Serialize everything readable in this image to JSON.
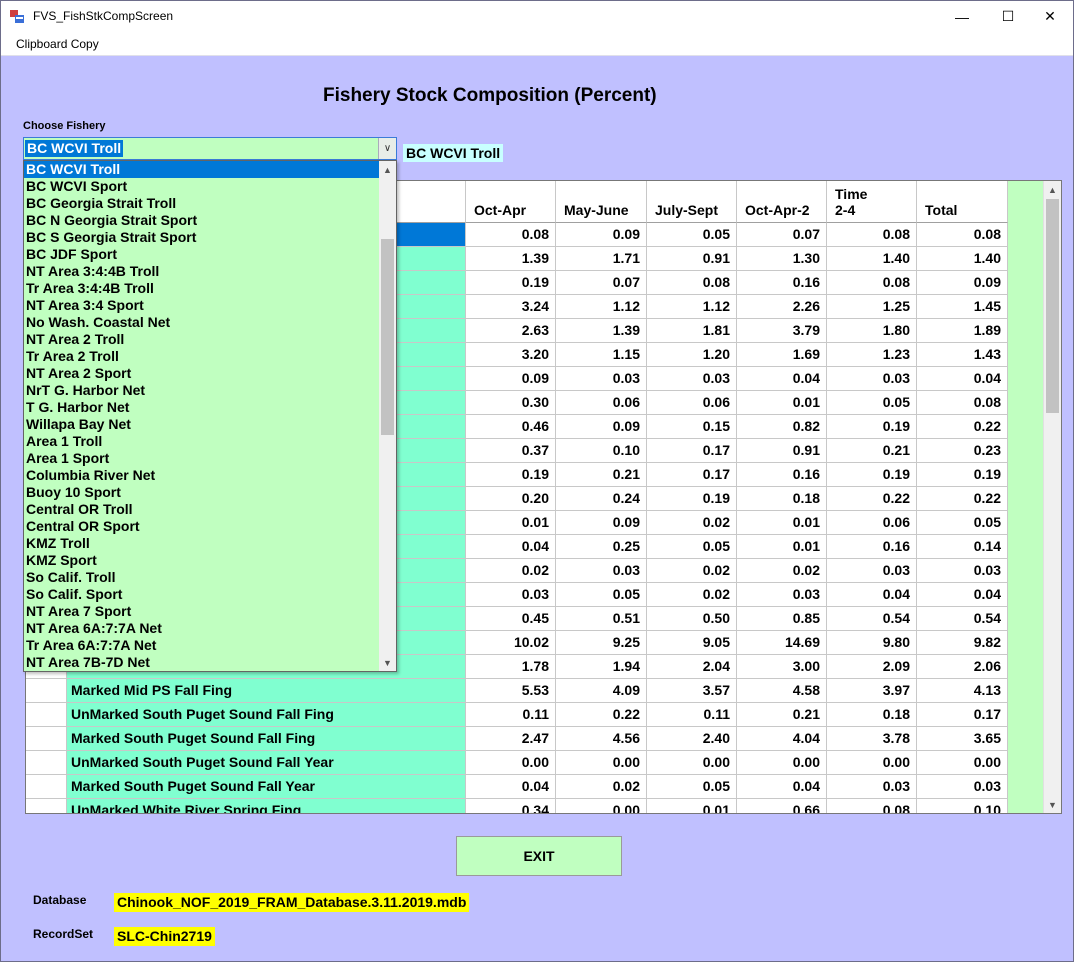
{
  "window": {
    "title": "FVS_FishStkCompScreen",
    "minimize_glyph": "—",
    "maximize_glyph": "☐",
    "close_glyph": "✕"
  },
  "menu": {
    "clipboard_copy": "Clipboard Copy"
  },
  "heading": "Fishery Stock Composition (Percent)",
  "choose_fishery": {
    "label": "Choose Fishery",
    "value": "BC WCVI Troll",
    "options": [
      "BC WCVI Troll",
      "BC WCVI Sport",
      "BC Georgia Strait Troll",
      "BC N Georgia Strait Sport",
      "BC S Georgia Strait Sport",
      "BC JDF Sport",
      "NT Area 3:4:4B Troll",
      "Tr Area 3:4:4B Troll",
      "NT Area 3:4 Sport",
      "No Wash. Coastal Net",
      "NT Area 2 Troll",
      "Tr Area 2 Troll",
      "NT Area 2 Sport",
      "NrT G. Harbor Net",
      "T G. Harbor Net",
      "Willapa Bay Net",
      "Area 1 Troll",
      "Area 1 Sport",
      "Columbia River Net",
      "Buoy 10 Sport",
      "Central OR Troll",
      "Central OR Sport",
      "KMZ Troll",
      "KMZ Sport",
      "So Calif. Troll",
      "So Calif. Sport",
      "NT Area 7 Sport",
      "NT Area 6A:7:7A Net",
      "Tr Area 6A:7:7A Net",
      "NT Area 7B-7D Net"
    ]
  },
  "selected_fishery_label": "BC WCVI Troll",
  "table": {
    "columns": [
      "Oct-Apr",
      "May-June",
      "July-Sept",
      "Oct-Apr-2",
      "Time\n2-4",
      "Total"
    ],
    "rows": [
      {
        "stock": "",
        "values": [
          "0.08",
          "0.09",
          "0.05",
          "0.07",
          "0.08",
          "0.08"
        ]
      },
      {
        "stock": "",
        "values": [
          "1.39",
          "1.71",
          "0.91",
          "1.30",
          "1.40",
          "1.40"
        ]
      },
      {
        "stock": "",
        "values": [
          "0.19",
          "0.07",
          "0.08",
          "0.16",
          "0.08",
          "0.09"
        ]
      },
      {
        "stock": "",
        "values": [
          "3.24",
          "1.12",
          "1.12",
          "2.26",
          "1.25",
          "1.45"
        ]
      },
      {
        "stock": "",
        "values": [
          "2.63",
          "1.39",
          "1.81",
          "3.79",
          "1.80",
          "1.89"
        ]
      },
      {
        "stock": "",
        "values": [
          "3.20",
          "1.15",
          "1.20",
          "1.69",
          "1.23",
          "1.43"
        ]
      },
      {
        "stock": "",
        "values": [
          "0.09",
          "0.03",
          "0.03",
          "0.04",
          "0.03",
          "0.04"
        ]
      },
      {
        "stock": "",
        "values": [
          "0.30",
          "0.06",
          "0.06",
          "0.01",
          "0.05",
          "0.08"
        ]
      },
      {
        "stock": "",
        "values": [
          "0.46",
          "0.09",
          "0.15",
          "0.82",
          "0.19",
          "0.22"
        ]
      },
      {
        "stock": "",
        "values": [
          "0.37",
          "0.10",
          "0.17",
          "0.91",
          "0.21",
          "0.23"
        ]
      },
      {
        "stock": "",
        "values": [
          "0.19",
          "0.21",
          "0.17",
          "0.16",
          "0.19",
          "0.19"
        ]
      },
      {
        "stock": "",
        "values": [
          "0.20",
          "0.24",
          "0.19",
          "0.18",
          "0.22",
          "0.22"
        ]
      },
      {
        "stock": "",
        "values": [
          "0.01",
          "0.09",
          "0.02",
          "0.01",
          "0.06",
          "0.05"
        ]
      },
      {
        "stock": "",
        "values": [
          "0.04",
          "0.25",
          "0.05",
          "0.01",
          "0.16",
          "0.14"
        ]
      },
      {
        "stock": "",
        "values": [
          "0.02",
          "0.03",
          "0.02",
          "0.02",
          "0.03",
          "0.03"
        ]
      },
      {
        "stock": "",
        "values": [
          "0.03",
          "0.05",
          "0.02",
          "0.03",
          "0.04",
          "0.04"
        ]
      },
      {
        "stock": "",
        "values": [
          "0.45",
          "0.51",
          "0.50",
          "0.85",
          "0.54",
          "0.54"
        ]
      },
      {
        "stock": "",
        "values": [
          "10.02",
          "9.25",
          "9.05",
          "14.69",
          "9.80",
          "9.82"
        ]
      },
      {
        "stock": "",
        "values": [
          "1.78",
          "1.94",
          "2.04",
          "3.00",
          "2.09",
          "2.06"
        ]
      },
      {
        "stock": "Marked Mid PS Fall Fing",
        "values": [
          "5.53",
          "4.09",
          "3.57",
          "4.58",
          "3.97",
          "4.13"
        ]
      },
      {
        "stock": "UnMarked South Puget Sound Fall Fing",
        "values": [
          "0.11",
          "0.22",
          "0.11",
          "0.21",
          "0.18",
          "0.17"
        ]
      },
      {
        "stock": "Marked South Puget Sound Fall Fing",
        "values": [
          "2.47",
          "4.56",
          "2.40",
          "4.04",
          "3.78",
          "3.65"
        ]
      },
      {
        "stock": "UnMarked South Puget Sound Fall Year",
        "values": [
          "0.00",
          "0.00",
          "0.00",
          "0.00",
          "0.00",
          "0.00"
        ]
      },
      {
        "stock": "Marked South Puget Sound Fall Year",
        "values": [
          "0.04",
          "0.02",
          "0.05",
          "0.04",
          "0.03",
          "0.03"
        ]
      },
      {
        "stock": "UnMarked White River Spring Fing",
        "values": [
          "0.34",
          "0.00",
          "0.01",
          "0.66",
          "0.08",
          "0.10"
        ]
      }
    ]
  },
  "exit_label": "EXIT",
  "database": {
    "label": "Database",
    "value": "Chinook_NOF_2019_FRAM_Database.3.11.2019.mdb"
  },
  "recordset": {
    "label": "RecordSet",
    "value": "SLC-Chin2719"
  }
}
